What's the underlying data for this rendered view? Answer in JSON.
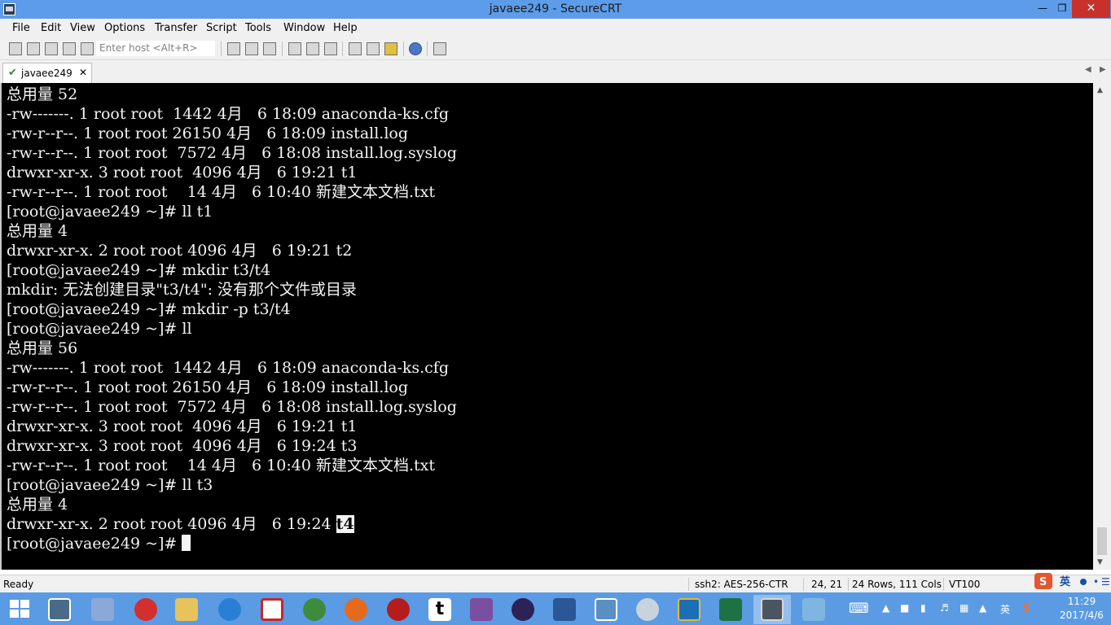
{
  "window": {
    "title": "javaee249 - SecureCRT"
  },
  "menu": [
    "File",
    "Edit",
    "View",
    "Options",
    "Transfer",
    "Script",
    "Tools",
    "Window",
    "Help"
  ],
  "toolbar": {
    "host_placeholder": "Enter host <Alt+R>"
  },
  "tab": {
    "label": "javaee249"
  },
  "terminal": {
    "lines": [
      "总用量 52",
      "-rw-------. 1 root root  1442 4月   6 18:09 anaconda-ks.cfg",
      "-rw-r--r--. 1 root root 26150 4月   6 18:09 install.log",
      "-rw-r--r--. 1 root root  7572 4月   6 18:08 install.log.syslog",
      "drwxr-xr-x. 3 root root  4096 4月   6 19:21 t1",
      "-rw-r--r--. 1 root root    14 4月   6 10:40 新建文本文档.txt",
      "[root@javaee249 ~]# ll t1",
      "总用量 4",
      "drwxr-xr-x. 2 root root 4096 4月   6 19:21 t2",
      "[root@javaee249 ~]# mkdir t3/t4",
      "mkdir: 无法创建目录\"t3/t4\": 没有那个文件或目录",
      "[root@javaee249 ~]# mkdir -p t3/t4",
      "[root@javaee249 ~]# ll",
      "总用量 56",
      "-rw-------. 1 root root  1442 4月   6 18:09 anaconda-ks.cfg",
      "-rw-r--r--. 1 root root 26150 4月   6 18:09 install.log",
      "-rw-r--r--. 1 root root  7572 4月   6 18:08 install.log.syslog",
      "drwxr-xr-x. 3 root root  4096 4月   6 19:21 t1",
      "drwxr-xr-x. 3 root root  4096 4月   6 19:24 t3",
      "-rw-r--r--. 1 root root    14 4月   6 10:40 新建文本文档.txt",
      "[root@javaee249 ~]# ll t3",
      "总用量 4",
      "drwxr-xr-x. 2 root root 4096 4月   6 19:24 ",
      "[root@javaee249 ~]# "
    ],
    "highlighted_item": "t4"
  },
  "status": {
    "ready": "Ready",
    "cipher": "ssh2: AES-256-CTR",
    "position": "24,  21",
    "size": "24 Rows, 111 Cols",
    "emulation": "VT100"
  },
  "taskbar": {
    "time": "11:29",
    "date": "2017/4/6",
    "ime_label": "英",
    "tray_lang": "英"
  },
  "colors": {
    "titlebar": "#5d9ce9",
    "terminal_bg": "#000000",
    "terminal_fg": "#f4f4f4",
    "taskbar": "#5b9be4",
    "close": "#c7302b"
  }
}
